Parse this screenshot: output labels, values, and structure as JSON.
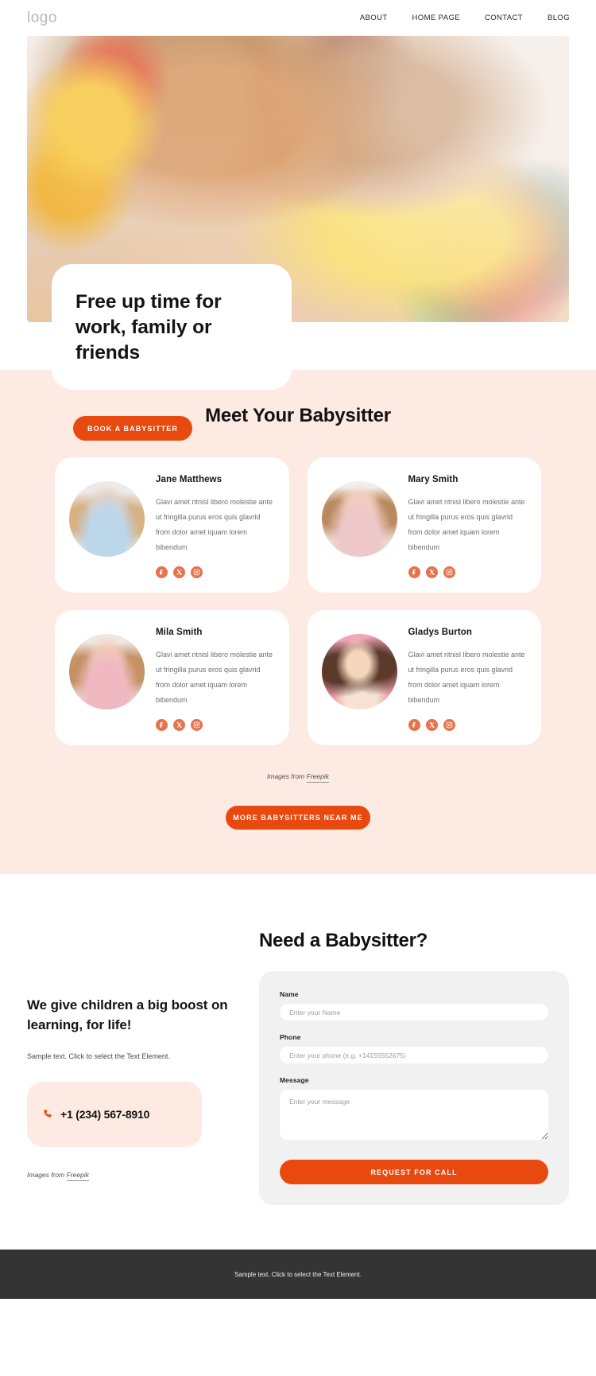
{
  "header": {
    "logo": "logo",
    "nav": [
      {
        "label": "ABOUT"
      },
      {
        "label": "HOME PAGE"
      },
      {
        "label": "CONTACT"
      },
      {
        "label": "BLOG"
      }
    ]
  },
  "hero": {
    "title": "Free up time  for work, family or friends",
    "cta_label": "BOOK A BABYSITTER"
  },
  "sitters_section": {
    "title": "Meet Your Babysitter",
    "credit_prefix": "Images from ",
    "credit_link": "Freepik",
    "more_label": "MORE BABYSITTERS NEAR ME",
    "social_icons": [
      "facebook-icon",
      "x-twitter-icon",
      "instagram-icon"
    ],
    "cards": [
      {
        "name": "Jane Matthews",
        "desc": "Glavi amet ritnisl libero molestie ante ut fringilla purus eros quis glavrid from dolor amet iquam lorem bibendum"
      },
      {
        "name": "Mary Smith",
        "desc": "Glavi amet ritnisl libero molestie ante ut fringilla purus eros quis glavrid from dolor amet iquam lorem bibendum"
      },
      {
        "name": "Mila Smith",
        "desc": "Glavi amet ritnisl libero molestie ante ut fringilla purus eros quis glavrid from dolor amet iquam lorem bibendum"
      },
      {
        "name": "Gladys Burton",
        "desc": "Glavi amet ritnisl libero molestie ante ut fringilla purus eros quis glavrid from dolor amet iquam lorem bibendum"
      }
    ]
  },
  "contact": {
    "left_heading": "We give children a big boost on learning, for life!",
    "left_text": "Sample text. Click to select the Text Element.",
    "phone_icon": "phone-icon",
    "phone": "+1 (234) 567-8910",
    "credit_prefix": "Images from ",
    "credit_link": "Freepik",
    "form": {
      "title": "Need a Babysitter?",
      "name_label": "Name",
      "name_value": "",
      "name_placeholder": "Enter your Name",
      "phone_label": "Phone",
      "phone_value": "",
      "phone_placeholder": "Enter your phone (e.g. +14155552675)",
      "message_label": "Message",
      "message_value": "",
      "message_placeholder": "Enter your message",
      "submit_label": "REQUEST FOR CALL"
    }
  },
  "footer": {
    "text": "Sample text. Click to select the Text Element."
  },
  "colors": {
    "accent": "#e8490f",
    "section_bg": "#fdeae3",
    "social": "#e8724b",
    "footer_bg": "#343434"
  }
}
